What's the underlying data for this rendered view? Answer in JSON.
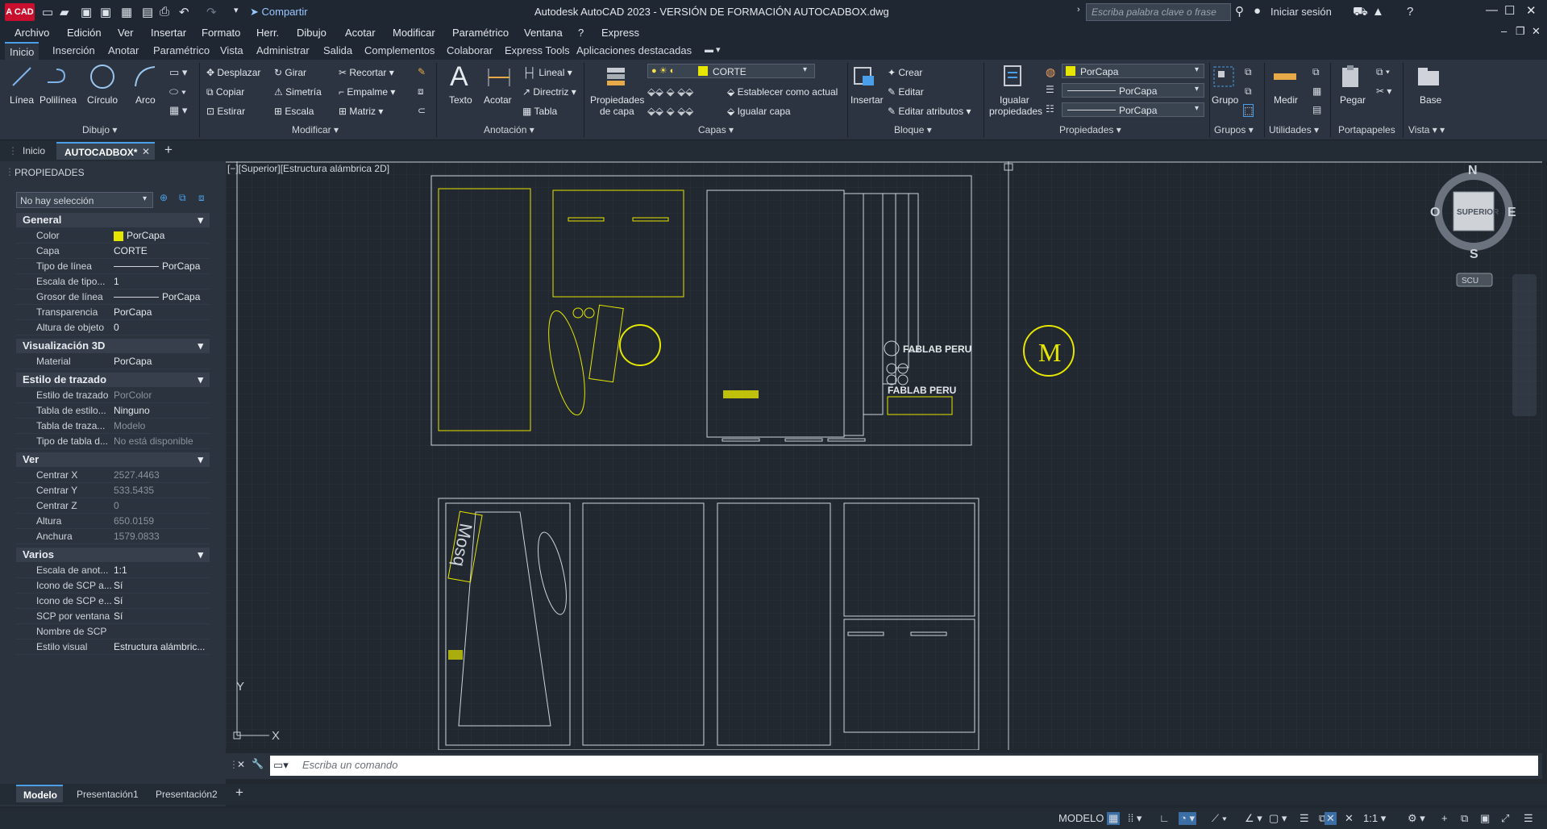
{
  "window": {
    "app_logo": "A CAD",
    "share_label": "Compartir",
    "title": "Autodesk AutoCAD 2023 - VERSIÓN DE FORMACIÓN    AUTOCADBOX.dwg",
    "search_placeholder": "Escriba palabra clave o frase",
    "login_label": "Iniciar sesión"
  },
  "menu": [
    "Archivo",
    "Edición",
    "Ver",
    "Insertar",
    "Formato",
    "Herr.",
    "Dibujo",
    "Acotar",
    "Modificar",
    "Paramétrico",
    "Ventana",
    "?",
    "Express"
  ],
  "ribbon_tabs": [
    "Inicio",
    "Inserción",
    "Anotar",
    "Paramétrico",
    "Vista",
    "Administrar",
    "Salida",
    "Complementos",
    "Colaborar",
    "Express Tools",
    "Aplicaciones destacadas"
  ],
  "ribbon": {
    "dibujo": {
      "linea": "Línea",
      "polilinea": "Polilínea",
      "circulo": "Círculo",
      "arco": "Arco",
      "title": "Dibujo"
    },
    "modificar": {
      "desplazar": "Desplazar",
      "girar": "Girar",
      "recortar": "Recortar",
      "copiar": "Copiar",
      "simetria": "Simetría",
      "empalme": "Empalme",
      "estirar": "Estirar",
      "escala": "Escala",
      "matriz": "Matriz",
      "title": "Modificar"
    },
    "anotacion": {
      "texto": "Texto",
      "acotar": "Acotar",
      "lineal": "Lineal",
      "directriz": "Directriz",
      "tabla": "Tabla",
      "title": "Anotación"
    },
    "capas": {
      "propiedades1": "Propiedades",
      "propiedades2": "de capa",
      "layer": "CORTE",
      "establecer": "Establecer como actual",
      "igualar": "Igualar capa",
      "title": "Capas"
    },
    "bloque": {
      "insertar": "Insertar",
      "crear": "Crear",
      "editar": "Editar",
      "editar_atributos": "Editar atributos",
      "title": "Bloque"
    },
    "propiedades": {
      "igualar1": "Igualar",
      "igualar2": "propiedades",
      "color": "PorCapa",
      "linetype": "PorCapa",
      "lineweight": "PorCapa",
      "title": "Propiedades"
    },
    "grupos": {
      "grupo": "Grupo",
      "title": "Grupos"
    },
    "utilidades": {
      "medir": "Medir",
      "title": "Utilidades"
    },
    "portapapeles": {
      "pegar": "Pegar",
      "title": "Portapapeles"
    },
    "vista": {
      "base": "Base",
      "title": "Vista"
    }
  },
  "doc_tabs": {
    "home": "Inicio",
    "active": "AUTOCADBOX*"
  },
  "properties": {
    "header": "PROPIEDADES",
    "selection": "No hay selección",
    "sections": {
      "general": {
        "title": "General",
        "rows": [
          [
            "Color",
            "PorCapa"
          ],
          [
            "Capa",
            "CORTE"
          ],
          [
            "Tipo de línea",
            "PorCapa"
          ],
          [
            "Escala de tipo...",
            "1"
          ],
          [
            "Grosor de línea",
            "PorCapa"
          ],
          [
            "Transparencia",
            "PorCapa"
          ],
          [
            "Altura de objeto",
            "0"
          ]
        ]
      },
      "vis3d": {
        "title": "Visualización 3D",
        "rows": [
          [
            "Material",
            "PorCapa"
          ]
        ]
      },
      "trazado": {
        "title": "Estilo de trazado",
        "rows": [
          [
            "Estilo de trazado",
            "PorColor"
          ],
          [
            "Tabla de estilo...",
            "Ninguno"
          ],
          [
            "Tabla de traza...",
            "Modelo"
          ],
          [
            "Tipo de tabla d...",
            "No está disponible"
          ]
        ]
      },
      "ver": {
        "title": "Ver",
        "rows": [
          [
            "Centrar X",
            "2527.4463"
          ],
          [
            "Centrar Y",
            "533.5435"
          ],
          [
            "Centrar Z",
            "0"
          ],
          [
            "Altura",
            "650.0159"
          ],
          [
            "Anchura",
            "1579.0833"
          ]
        ]
      },
      "varios": {
        "title": "Varios",
        "rows": [
          [
            "Escala de anot...",
            "1:1"
          ],
          [
            "Icono de SCP a...",
            "Sí"
          ],
          [
            "Icono de SCP e...",
            "Sí"
          ],
          [
            "SCP por ventana",
            "Sí"
          ],
          [
            "Nombre de SCP",
            ""
          ],
          [
            "Estilo visual",
            "Estructura  alámbric..."
          ]
        ]
      }
    }
  },
  "viewport": {
    "label": "[−][Superior][Estructura alámbrica 2D]",
    "fablab1": "FABLAB PERU",
    "fablab2": "FABLAB PERU",
    "mosq": "Mosq",
    "logo_letter": "M",
    "viewcube": {
      "n": "N",
      "s": "S",
      "e": "E",
      "o": "O",
      "center": "SUPERIOR",
      "scu": "SCU"
    },
    "ucs_x": "X",
    "ucs_y": "Y"
  },
  "command": {
    "placeholder": "Escriba un comando"
  },
  "layout_tabs": [
    "Modelo",
    "Presentación1",
    "Presentación2"
  ],
  "status": {
    "mode": "MODELO",
    "scale": "1:1"
  },
  "colors": {
    "accent": "#4a9fe8",
    "yellow": "#e6e600",
    "bg": "#212830"
  }
}
